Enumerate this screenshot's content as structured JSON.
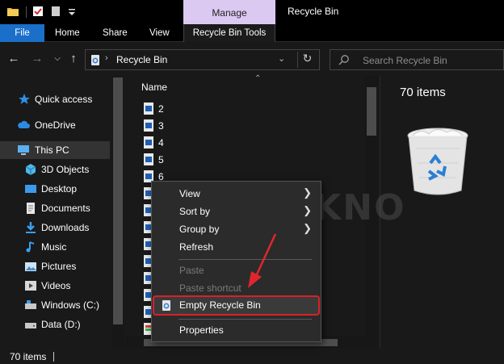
{
  "title_bar": {
    "manage_label": "Manage",
    "window_title": "Recycle Bin"
  },
  "ribbon": {
    "tabs": [
      "File",
      "Home",
      "Share",
      "View"
    ],
    "contextual_tab": "Recycle Bin Tools"
  },
  "address": {
    "path": "Recycle Bin",
    "search_placeholder": "Search Recycle Bin"
  },
  "nav_pane": {
    "items": [
      {
        "label": "Quick access",
        "icon": "star-icon"
      },
      {
        "label": "OneDrive",
        "icon": "cloud-icon"
      },
      {
        "label": "This PC",
        "icon": "computer-icon"
      },
      {
        "label": "3D Objects",
        "icon": "cube-icon"
      },
      {
        "label": "Desktop",
        "icon": "desktop-icon"
      },
      {
        "label": "Documents",
        "icon": "documents-icon"
      },
      {
        "label": "Downloads",
        "icon": "downloads-icon"
      },
      {
        "label": "Music",
        "icon": "music-icon"
      },
      {
        "label": "Pictures",
        "icon": "pictures-icon"
      },
      {
        "label": "Videos",
        "icon": "videos-icon"
      },
      {
        "label": "Windows (C:)",
        "icon": "drive-icon"
      },
      {
        "label": "Data (D:)",
        "icon": "drive-icon"
      }
    ]
  },
  "file_list": {
    "column_name": "Name",
    "files": [
      "2",
      "3",
      "4",
      "5",
      "6"
    ]
  },
  "preview": {
    "item_count": "70 items"
  },
  "status_bar": {
    "item_count": "70 items"
  },
  "context_menu": {
    "view": "View",
    "sort_by": "Sort by",
    "group_by": "Group by",
    "refresh": "Refresh",
    "paste": "Paste",
    "paste_shortcut": "Paste shortcut",
    "empty_recycle_bin": "Empty Recycle Bin",
    "properties": "Properties"
  },
  "watermark": "BAGITEKNO",
  "colors": {
    "accent": "#1a6fc9",
    "manage_tab": "#dcc9f2",
    "highlight_border": "#d8212a"
  }
}
